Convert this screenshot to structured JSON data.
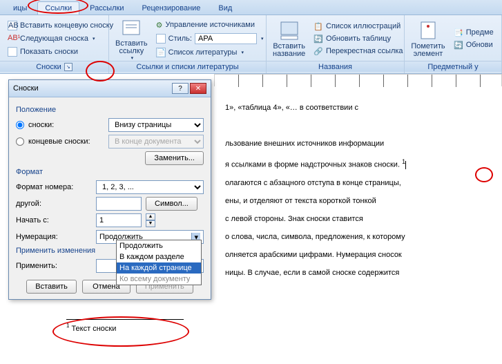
{
  "tabs": {
    "t0": "ицы",
    "t1": "Ссылки",
    "t2": "Рассылки",
    "t3": "Рецензирование",
    "t4": "Вид"
  },
  "ribbon": {
    "footnotes": {
      "item1": "Вставить концевую сноску",
      "item2": "Следующая сноска",
      "item3": "Показать сноски",
      "label": "Сноски"
    },
    "insert_ref": {
      "btn": "Вставить\nссылку",
      "label": "Ссылки и списки литературы",
      "i1": "Управление источниками",
      "i2": "Стиль:",
      "style_val": "APA",
      "i3": "Список литературы"
    },
    "caption": {
      "btn": "Вставить\nназвание",
      "label": "Названия",
      "i1": "Список иллюстраций",
      "i2": "Обновить таблицу",
      "i3": "Перекрестная ссылка"
    },
    "index": {
      "btn": "Пометить\nэлемент",
      "label": "Предметный у",
      "i1": "Предме",
      "i2": "Обнови"
    }
  },
  "dialog": {
    "title": "Сноски",
    "sect_pos": "Положение",
    "opt_footnotes": "сноски:",
    "opt_footnotes_val": "Внизу страницы",
    "opt_endnotes": "концевые сноски:",
    "opt_endnotes_val": "В конце документа",
    "btn_replace": "Заменить...",
    "sect_fmt": "Формат",
    "l_numfmt": "Формат номера:",
    "v_numfmt": "1, 2, 3, ...",
    "l_other": "другой:",
    "btn_symbol": "Символ...",
    "l_start": "Начать с:",
    "v_start": "1",
    "l_numbering": "Нумерация:",
    "v_numbering": "Продолжить",
    "sect_apply": "Применить изменения",
    "l_applyto": "Применить:",
    "btn_insert": "Вставить",
    "btn_cancel": "Отмена",
    "btn_apply": "Применить",
    "combo": {
      "o1": "Продолжить",
      "o2": "В каждом разделе",
      "o3": "На каждой странице",
      "o4": "Ко всему документу"
    }
  },
  "page": {
    "l1": "1»,  «таблица  4»,  «…  в  соответствии  с",
    "l3": "льзование   внешних   источников   информации",
    "l4": "я ссылками в форме надстрочных знаков сноски.",
    "l5": "олагаются с абзацного отступа в конце страницы,",
    "l6": "ены,  и  отделяют  от  текста  короткой  тонкой",
    "l7": "с   левой   стороны.   Знак   сноски   ставится",
    "l8": "о слова, числа, символа, предложения, к которому",
    "l9": "олняется арабскими цифрами. Нумерация сносок",
    "l10": "ницы. В случае, если в самой сноске содержится"
  },
  "footnote": {
    "text": "Текст сноски",
    "mark": "1"
  }
}
